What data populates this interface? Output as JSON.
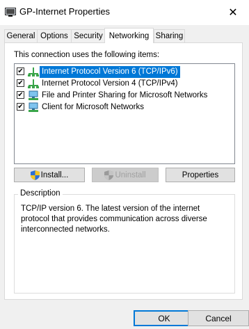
{
  "window": {
    "title": "GP-Internet Properties",
    "close_glyph": "✕"
  },
  "tabs": [
    {
      "label": "General",
      "active": false
    },
    {
      "label": "Options",
      "active": false
    },
    {
      "label": "Security",
      "active": false
    },
    {
      "label": "Networking",
      "active": true
    },
    {
      "label": "Sharing",
      "active": false
    }
  ],
  "networking": {
    "items_caption": "This connection uses the following items:",
    "items": [
      {
        "label": "Internet Protocol Version 6 (TCP/IPv6)",
        "checked": true,
        "selected": true,
        "icon": "network-protocol-icon"
      },
      {
        "label": "Internet Protocol Version 4 (TCP/IPv4)",
        "checked": true,
        "selected": false,
        "icon": "network-protocol-icon"
      },
      {
        "label": "File and Printer Sharing for Microsoft Networks",
        "checked": true,
        "selected": false,
        "icon": "network-service-icon"
      },
      {
        "label": "Client for Microsoft Networks",
        "checked": true,
        "selected": false,
        "icon": "network-client-icon"
      }
    ],
    "install_label": "Install...",
    "uninstall_label": "Uninstall",
    "properties_label": "Properties",
    "description_title": "Description",
    "description_text": "TCP/IP version 6. The latest version of the internet protocol that provides communication across diverse interconnected networks."
  },
  "footer": {
    "ok_label": "OK",
    "cancel_label": "Cancel"
  },
  "colors": {
    "selection": "#0078d7",
    "dialog_bg": "#f0f0f0"
  }
}
